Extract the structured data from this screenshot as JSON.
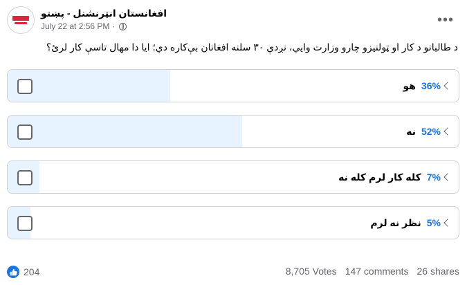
{
  "post": {
    "page_name": "افغانستان انټرنشنل - پښتو",
    "timestamp": "July 22 at 2:56 PM",
    "separator": "·",
    "question": "د طالبانو د کار او ټولنيزو چارو وزارت وايي، نږدې ۳۰ سلنه افغانان بې‌کاره دي؛ ايا دا مهال تاسې کار لرئ؟"
  },
  "poll": {
    "options": [
      {
        "label": "هو",
        "percent_text": "36%",
        "percent": 36
      },
      {
        "label": "نه",
        "percent_text": "52%",
        "percent": 52
      },
      {
        "label": "کله کار لرم کله نه",
        "percent_text": "7%",
        "percent": 7
      },
      {
        "label": "نظر نه لرم",
        "percent_text": "5%",
        "percent": 5
      }
    ]
  },
  "footer": {
    "reaction_count": "204",
    "votes": "8,705 Votes",
    "comments": "147 comments",
    "shares": "26 shares"
  },
  "icons": {
    "like": "thumbs-up-icon",
    "privacy": "globe-icon",
    "more": "more-options-icon"
  },
  "colors": {
    "accent": "#1b74e4",
    "fill": "#e7f3ff",
    "border": "#ced0d4",
    "secondary_text": "#65676b"
  }
}
